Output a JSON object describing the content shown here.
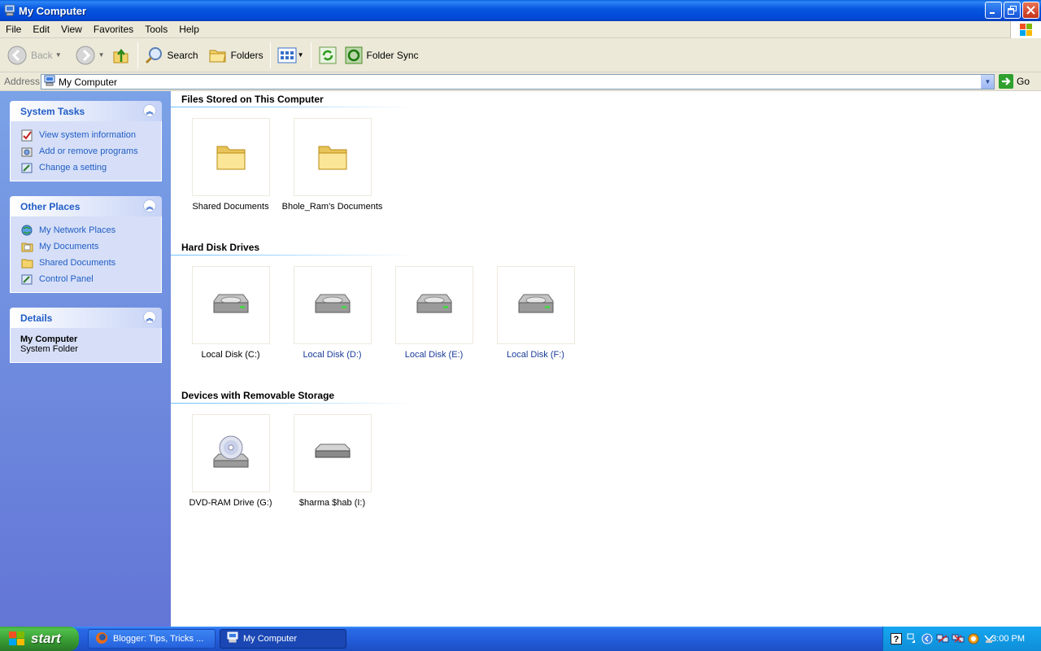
{
  "window": {
    "title": "My Computer"
  },
  "menu": [
    "File",
    "Edit",
    "View",
    "Favorites",
    "Tools",
    "Help"
  ],
  "toolbar": {
    "back_label": "Back",
    "search_label": "Search",
    "folders_label": "Folders",
    "foldersync_label": "Folder Sync"
  },
  "address": {
    "label": "Address",
    "value": "My Computer",
    "go_label": "Go"
  },
  "system_tasks": {
    "title": "System Tasks",
    "items": [
      {
        "label": "View system information",
        "icon": "system-info-icon"
      },
      {
        "label": "Add or remove programs",
        "icon": "add-remove-programs-icon"
      },
      {
        "label": "Change a setting",
        "icon": "control-panel-icon"
      }
    ]
  },
  "other_places": {
    "title": "Other Places",
    "items": [
      {
        "label": "My Network Places",
        "icon": "network-places-icon"
      },
      {
        "label": "My Documents",
        "icon": "my-documents-icon"
      },
      {
        "label": "Shared Documents",
        "icon": "folder-icon"
      },
      {
        "label": "Control Panel",
        "icon": "control-panel-icon"
      }
    ]
  },
  "details": {
    "title": "Details",
    "name": "My Computer",
    "type": "System Folder"
  },
  "groups": {
    "files": {
      "title": "Files Stored on This Computer",
      "items": [
        {
          "label": "Shared Documents"
        },
        {
          "label": "Bhole_Ram's Documents"
        }
      ]
    },
    "drives": {
      "title": "Hard Disk Drives",
      "items": [
        {
          "label": "Local Disk (C:)"
        },
        {
          "label": "Local Disk (D:)"
        },
        {
          "label": "Local Disk (E:)"
        },
        {
          "label": "Local Disk (F:)"
        }
      ]
    },
    "removable": {
      "title": "Devices with Removable Storage",
      "items": [
        {
          "label": "DVD-RAM Drive (G:)"
        },
        {
          "label": "$harma $hab (I:)"
        }
      ]
    }
  },
  "taskbar": {
    "start_label": "start",
    "tasks": [
      {
        "label": "Blogger: Tips, Tricks ...",
        "icon": "firefox-icon"
      },
      {
        "label": "My Computer",
        "icon": "my-computer-icon"
      }
    ],
    "clock": "3:00 PM"
  },
  "colors": {
    "title_bar": "#0054e3",
    "task_pane_bg": "#6375d6",
    "link_blue": "#215dc6",
    "start_green": "#379a32"
  }
}
